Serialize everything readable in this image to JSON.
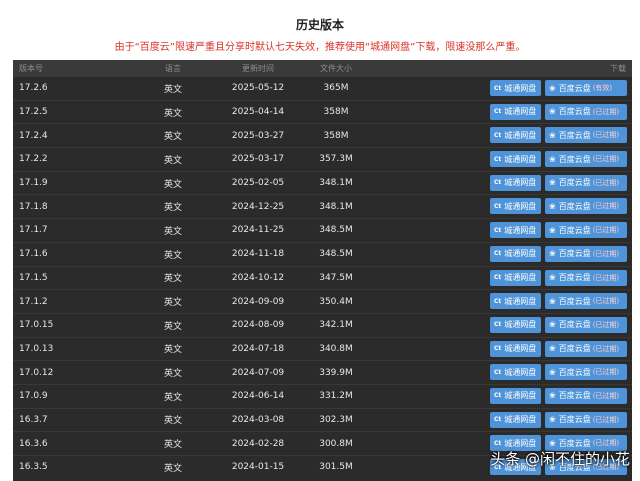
{
  "title": "历史版本",
  "notice": "由于“百度云”限速严重且分享时默认七天失效，推荐使用“城通网盘”下载，限速没那么严重。",
  "columns": {
    "version": "版本号",
    "language": "语言",
    "date": "更新时间",
    "size": "文件大小",
    "download": "下载"
  },
  "buttons": {
    "ct_icon": "Ct",
    "ct_label": "城通网盘",
    "baidu_label": "百度云盘"
  },
  "rows": [
    {
      "version": "17.2.6",
      "language": "英文",
      "date": "2025-05-12",
      "size": "365M",
      "status": "(有效)"
    },
    {
      "version": "17.2.5",
      "language": "英文",
      "date": "2025-04-14",
      "size": "358M",
      "status": "(已过期)"
    },
    {
      "version": "17.2.4",
      "language": "英文",
      "date": "2025-03-27",
      "size": "358M",
      "status": "(已过期)"
    },
    {
      "version": "17.2.2",
      "language": "英文",
      "date": "2025-03-17",
      "size": "357.3M",
      "status": "(已过期)"
    },
    {
      "version": "17.1.9",
      "language": "英文",
      "date": "2025-02-05",
      "size": "348.1M",
      "status": "(已过期)"
    },
    {
      "version": "17.1.8",
      "language": "英文",
      "date": "2024-12-25",
      "size": "348.1M",
      "status": "(已过期)"
    },
    {
      "version": "17.1.7",
      "language": "英文",
      "date": "2024-11-25",
      "size": "348.5M",
      "status": "(已过期)"
    },
    {
      "version": "17.1.6",
      "language": "英文",
      "date": "2024-11-18",
      "size": "348.5M",
      "status": "(已过期)"
    },
    {
      "version": "17.1.5",
      "language": "英文",
      "date": "2024-10-12",
      "size": "347.5M",
      "status": "(已过期)"
    },
    {
      "version": "17.1.2",
      "language": "英文",
      "date": "2024-09-09",
      "size": "350.4M",
      "status": "(已过期)"
    },
    {
      "version": "17.0.15",
      "language": "英文",
      "date": "2024-08-09",
      "size": "342.1M",
      "status": "(已过期)"
    },
    {
      "version": "17.0.13",
      "language": "英文",
      "date": "2024-07-18",
      "size": "340.8M",
      "status": "(已过期)"
    },
    {
      "version": "17.0.12",
      "language": "英文",
      "date": "2024-07-09",
      "size": "339.9M",
      "status": "(已过期)"
    },
    {
      "version": "17.0.9",
      "language": "英文",
      "date": "2024-06-14",
      "size": "331.2M",
      "status": "(已过期)"
    },
    {
      "version": "16.3.7",
      "language": "英文",
      "date": "2024-03-08",
      "size": "302.3M",
      "status": "(已过期)"
    },
    {
      "version": "16.3.6",
      "language": "英文",
      "date": "2024-02-28",
      "size": "300.8M",
      "status": "(已过期)"
    },
    {
      "version": "16.3.5",
      "language": "英文",
      "date": "2024-01-15",
      "size": "301.5M",
      "status": "(已过期)"
    }
  ],
  "watermark": "头条 @闲不住的小花"
}
